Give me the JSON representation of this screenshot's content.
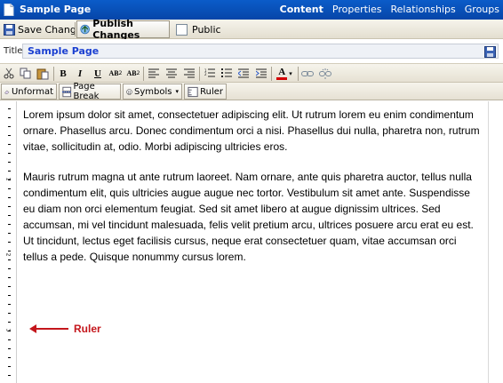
{
  "window": {
    "title": "Sample Page",
    "nav": [
      {
        "label": "Content",
        "active": true
      },
      {
        "label": "Properties",
        "active": false
      },
      {
        "label": "Relationships",
        "active": false
      },
      {
        "label": "Groups",
        "active": false
      }
    ]
  },
  "actions": {
    "save_label": "Save Changes",
    "publish_label": "Publish Changes",
    "public_label": "Public",
    "public_checked": false
  },
  "title_field": {
    "label": "Title",
    "value": "Sample Page"
  },
  "toolbar": {
    "bold": "B",
    "italic": "I",
    "underline": "U",
    "superscript": "AB",
    "subscript": "AB",
    "unformat_label": "Unformat",
    "page_break_label": "Page Break",
    "symbols_label": "Symbols",
    "ruler_label": "Ruler",
    "font_color_glyph": "A",
    "font_color": "#d40000"
  },
  "editor": {
    "paragraphs": [
      "Lorem ipsum dolor sit amet, consectetuer adipiscing elit. Ut rutrum lorem eu enim condimentum ornare. Phasellus arcu. Donec condimentum orci a nisi. Phasellus dui nulla, pharetra non, rutrum vitae, sollicitudin at, odio. Morbi adipiscing ultricies eros.",
      "Mauris rutrum magna ut ante rutrum laoreet. Nam ornare, ante quis pharetra auctor, tellus nulla condimentum elit, quis ultricies augue augue nec tortor. Vestibulum sit amet ante. Suspendisse eu diam non orci elementum feugiat. Sed sit amet libero at augue dignissim ultrices. Sed accumsan, mi vel tincidunt malesuada, felis velit pretium arcu, ultrices posuere arcu erat eu est. Ut tincidunt, lectus eget facilisis cursus, neque erat consectetuer quam, vitae accumsan orci tellus a pede. Quisque nonummy cursus lorem."
    ],
    "ruler_numbers": [
      "1",
      "2",
      "3"
    ]
  },
  "annotation": {
    "label": "Ruler",
    "color": "#c4161c"
  },
  "colors": {
    "titlebar": "#0b5cc9",
    "toolbar": "#ece9d8",
    "title_text": "#1a3fd1"
  }
}
